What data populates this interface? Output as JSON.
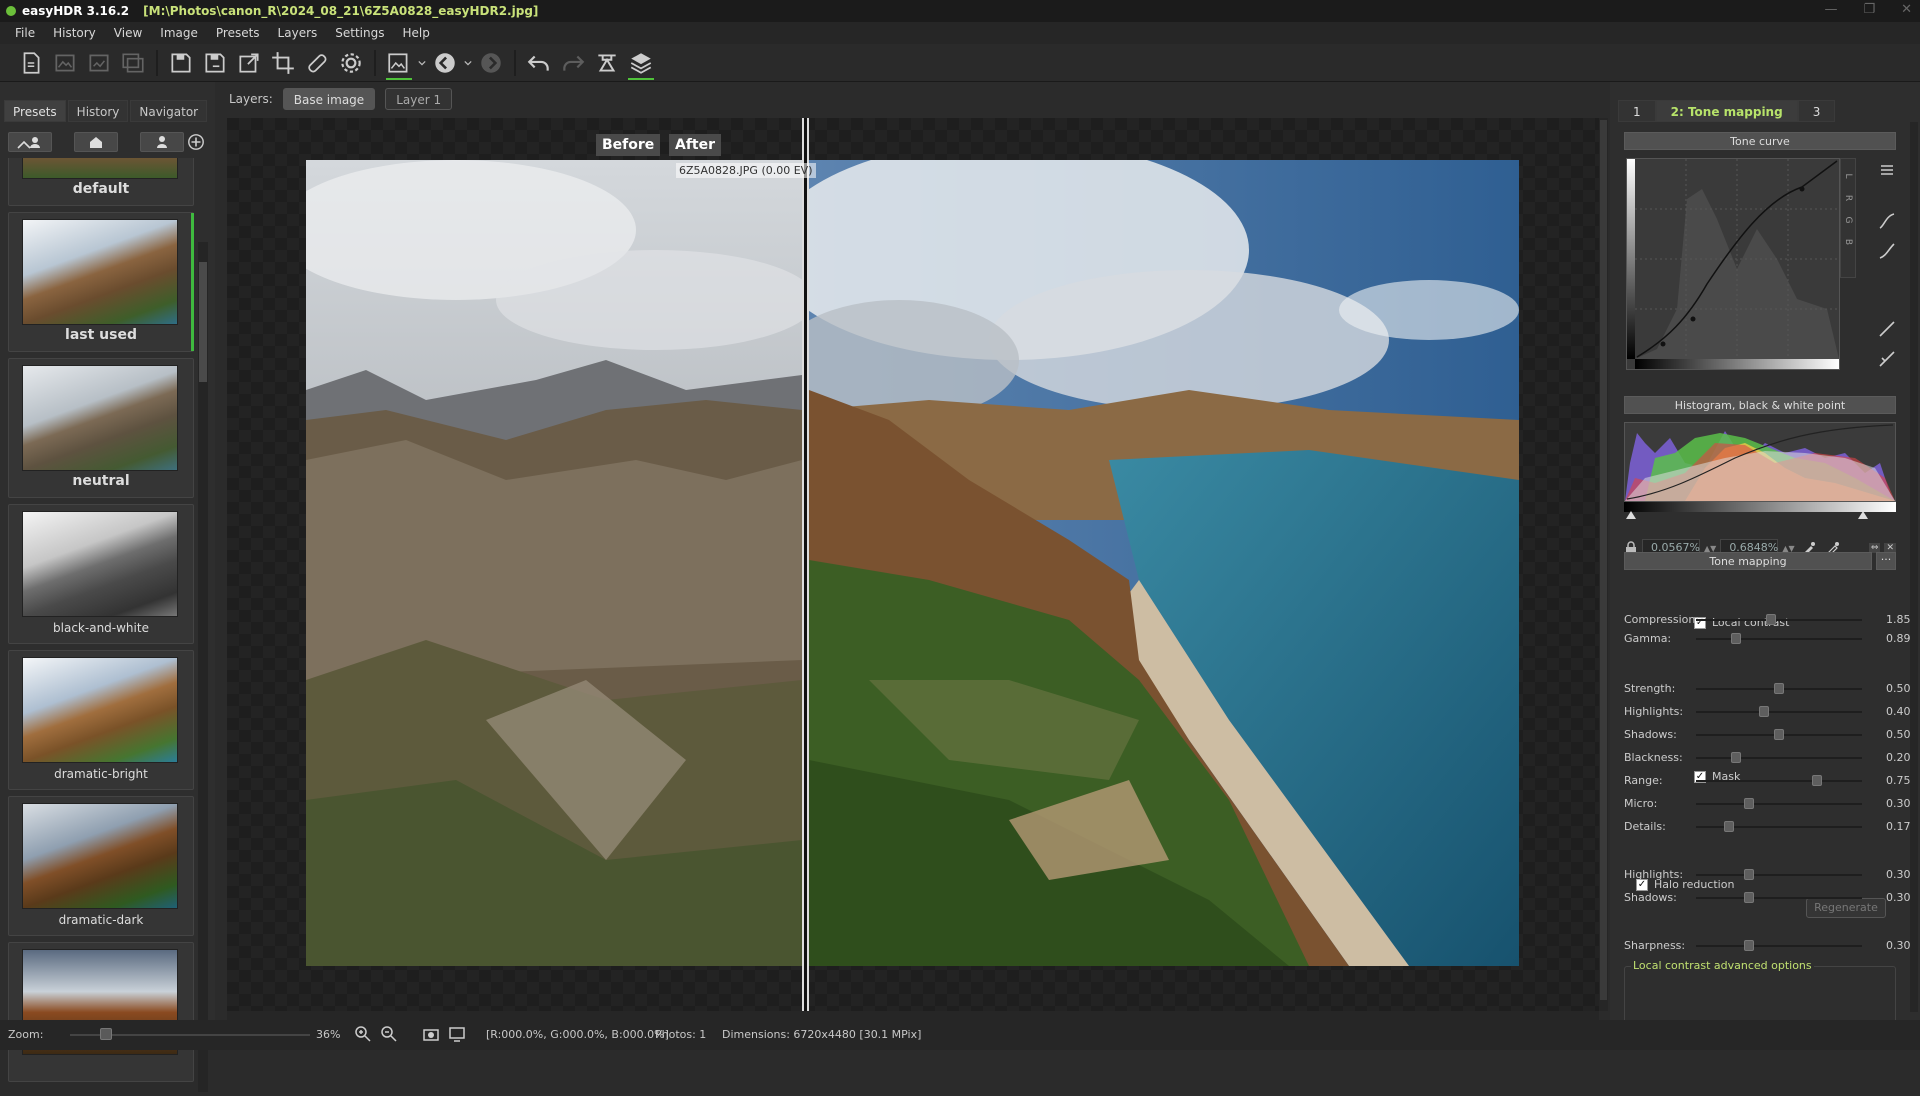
{
  "window": {
    "app_title": "easyHDR 3.16.2",
    "file_path": "[M:\\Photos\\canon_R\\2024_08_21\\6Z5A0828_easyHDR2.jpg]",
    "minimize_icon": "minimize-icon",
    "maximize_icon": "maximize-icon",
    "close_icon": "close-icon"
  },
  "menu": [
    "File",
    "History",
    "View",
    "Image",
    "Presets",
    "Layers",
    "Settings",
    "Help"
  ],
  "toolbar": {
    "icons": [
      "open-file-icon",
      "load-images-icon",
      "batch-icon",
      "merge-icon",
      "save-icon",
      "save-as-icon",
      "export-icon",
      "crop-icon",
      "healing-brush-icon",
      "settings-icon",
      "image-mode-icon",
      "back-icon",
      "forward-icon",
      "undo-icon",
      "redo-icon",
      "clear-icon",
      "layers-icon"
    ]
  },
  "left_panel": {
    "tabs": [
      "Presets",
      "History",
      "Navigator"
    ],
    "presets": [
      {
        "label": "default"
      },
      {
        "label": "last used"
      },
      {
        "label": "neutral"
      },
      {
        "label": "black-and-white"
      },
      {
        "label": "dramatic-bright"
      },
      {
        "label": "dramatic-dark"
      }
    ]
  },
  "layers": {
    "label": "Layers:",
    "items": [
      "Base image",
      "Layer 1"
    ]
  },
  "canvas": {
    "before_label": "Before",
    "after_label": "After",
    "file_info": "6Z5A0828.JPG (0.00 EV)"
  },
  "right_panel": {
    "tabs": [
      "1",
      "2: Tone mapping",
      "3"
    ],
    "curve_header": "Tone curve",
    "curve_channels": [
      "L",
      "R",
      "G",
      "B"
    ],
    "histogram_header": "Histogram, black & white point",
    "black_point": "0.0567%",
    "white_point": "0.6848%",
    "tonemap_header": "Tone mapping",
    "tonemap_menu": "···",
    "sliders1": [
      {
        "label": "Compression:",
        "value": "1.85",
        "level": 0.45
      },
      {
        "label": "Gamma:",
        "value": "0.89",
        "level": 0.24
      }
    ],
    "local_contrast_label": "Local contrast",
    "sliders2": [
      {
        "label": "Strength:",
        "value": "0.50",
        "level": 0.5
      },
      {
        "label": "Highlights:",
        "value": "0.40",
        "level": 0.41
      },
      {
        "label": "Shadows:",
        "value": "0.50",
        "level": 0.5
      },
      {
        "label": "Blackness:",
        "value": "0.20",
        "level": 0.24
      },
      {
        "label": "Range:",
        "value": "0.75",
        "level": 0.73
      },
      {
        "label": "Micro:",
        "value": "0.30",
        "level": 0.32
      },
      {
        "label": "Details:",
        "value": "0.17",
        "level": 0.2
      }
    ],
    "mask_label": "Mask",
    "sliders3": [
      {
        "label": "Highlights:",
        "value": "0.30",
        "level": 0.32
      },
      {
        "label": "Shadows:",
        "value": "0.30",
        "level": 0.32
      }
    ],
    "sharpness": {
      "label": "Sharpness:",
      "value": "0.30",
      "level": 0.32
    },
    "advanced_group": "Local contrast advanced options",
    "halo_label": "Halo reduction",
    "regenerate_label": "Regenerate"
  },
  "status": {
    "zoom_label": "Zoom:",
    "zoom_value": "36%",
    "rgb_readout": "[R:000.0%, G:000.0%, B:000.0%]",
    "photos": "Photos: 1",
    "dimensions": "Dimensions: 6720x4480 [30.1 MPix]"
  },
  "colors": {
    "accent": "#4fc23a",
    "title_path": "#c9e27a",
    "active_tab": "#b7e36a"
  }
}
